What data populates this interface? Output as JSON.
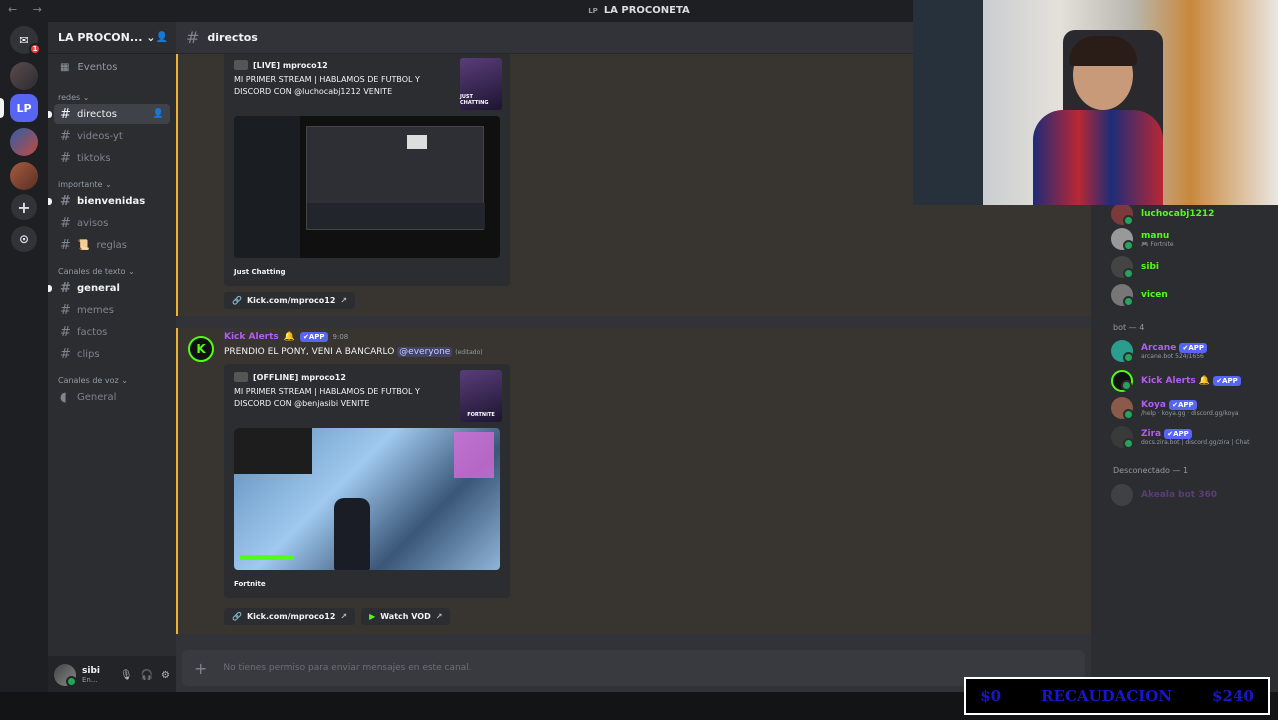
{
  "window": {
    "title": "LA PROCONETA",
    "nav": "← →",
    "server_badge": "LP"
  },
  "rail": {
    "dm_badge": "1",
    "lp_label": "LP",
    "add": "+",
    "discover": "⊙"
  },
  "server": {
    "name": "LA PROCON...",
    "chevron": "⌄",
    "events_label": "Eventos"
  },
  "categories": {
    "redes": "redes ⌄",
    "importante": "importante ⌄",
    "texto": "Canales de texto ⌄",
    "voz": "Canales de voz ⌄"
  },
  "channels": {
    "directos": "directos",
    "videos": "videos-yt",
    "tiktoks": "tiktoks",
    "bienvenidas": "bienvenidas",
    "avisos": "avisos",
    "reglas": "reglas",
    "general": "general",
    "memes": "memes",
    "factos": "factos",
    "clips": "clips",
    "voice_general": "General"
  },
  "user": {
    "name": "sibi",
    "status": "En...",
    "mic": "🎙",
    "headset": "🎧",
    "settings": "⚙"
  },
  "chat": {
    "channel": "directos",
    "composer_placeholder": "No tienes permiso para enviar mensajes en este canal.",
    "plus": "+"
  },
  "message1": {
    "embed_author": "[LIVE] mproco12",
    "embed_title": "MI PRIMER STREAM | HABLAMOS DE FUTBOL Y DISCORD CON @luchocabj1212 VENITE",
    "thumb_text": "JUST CHATTING",
    "game": "Just Chatting",
    "link": "Kick.com/mproco12"
  },
  "message2": {
    "author": "Kick Alerts",
    "bell": "🔔",
    "app_tag": "✔APP",
    "time": "9:08",
    "text": "PRENDIO EL PONY, VENI A BANCARLO ",
    "mention": "@everyone",
    "edited": "(editado)",
    "embed_author": "[OFFLINE] mproco12",
    "embed_title": "MI PRIMER STREAM | HABLAMOS DE FUTBOL Y DISCORD CON @benjasibi VENITE",
    "thumb_text": "FORTNITE",
    "game": "Fortnite",
    "link": "Kick.com/mproco12",
    "vod": "Watch VOD"
  },
  "members": {
    "online": [
      {
        "name": "luchocabj1212",
        "sub": ""
      },
      {
        "name": "manu",
        "sub": "🎮 Fortnite"
      },
      {
        "name": "sibi",
        "sub": ""
      },
      {
        "name": "vicen",
        "sub": ""
      }
    ],
    "bot_header": "bot — 4",
    "bots": [
      {
        "name": "Arcane",
        "sub": "arcane.bot 524/1656"
      },
      {
        "name": "Kick Alerts",
        "sub": ""
      },
      {
        "name": "Koya",
        "sub": "/help · koya.gg · discord.gg/koya"
      },
      {
        "name": "Zira",
        "sub": "docs.zira.bot | discord.gg/zira | Chat"
      }
    ],
    "offline_header": "Desconectado — 1",
    "offline": [
      {
        "name": "Akeala bot 360"
      }
    ]
  },
  "overlay": {
    "left": "$0",
    "label": "RECAUDACION",
    "right": "$240"
  },
  "colors": {
    "kick_green": "#53fc18",
    "accent": "#5865f2",
    "bot_purple": "#b45cf0",
    "highlight": "#f0b232"
  }
}
